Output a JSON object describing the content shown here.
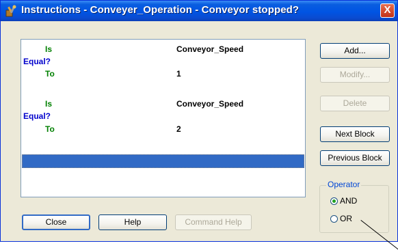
{
  "window": {
    "title": "Instructions - Conveyer_Operation - Conveyor stopped?",
    "close_glyph": "X"
  },
  "instructions": {
    "block1": {
      "kw1": "Is",
      "kw2": "Equal?",
      "kw3": "To",
      "field": "Conveyor_Speed",
      "value": "1"
    },
    "block2": {
      "kw1": "Is",
      "kw2": "Equal?",
      "kw3": "To",
      "field": "Conveyor_Speed",
      "value": "2"
    }
  },
  "buttons": {
    "add": "Add...",
    "modify": "Modify...",
    "delete": "Delete",
    "next_block": "Next Block",
    "previous_block": "Previous Block",
    "close": "Close",
    "help": "Help",
    "command_help": "Command Help"
  },
  "operator": {
    "legend": "Operator",
    "and_label": "AND",
    "or_label": "OR",
    "selected": "AND"
  },
  "colors": {
    "titlebar": "#0054e3",
    "selection": "#316ac5",
    "keyword_green": "#008000",
    "keyword_blue": "#0000cc"
  },
  "icons": {
    "title_icon": "tools-icon",
    "close_icon": "close-icon"
  }
}
